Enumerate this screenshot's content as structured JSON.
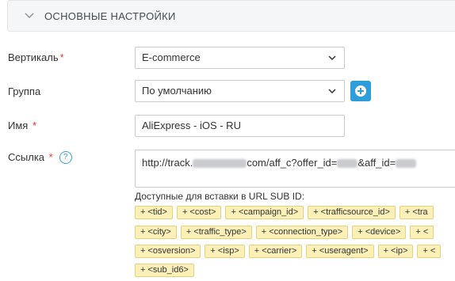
{
  "section": {
    "title": "ОСНОВНЫЕ НАСТРОЙКИ",
    "icon": "chevron-down-icon"
  },
  "form": {
    "vertical": {
      "label": "Вертикаль",
      "required_mark": "*",
      "value": "E-commerce"
    },
    "group": {
      "label": "Группа",
      "value": "По умолчанию",
      "add_icon": "plus-circle-icon"
    },
    "name": {
      "label": "Имя",
      "required_mark": "*",
      "value": "AliExpress - iOS - RU"
    },
    "link": {
      "label": "Ссылка",
      "required_mark": "*",
      "help": "?",
      "url_parts": [
        "http://track.",
        "com/aff_c?offer_id=",
        "&aff_id="
      ]
    }
  },
  "macros": {
    "title": "Доступные для вставки в URL SUB ID:",
    "rows": [
      [
        "+ <tid>",
        "+ <cost>",
        "+ <campaign_id>",
        "+ <trafficsource_id>",
        "+ <tra"
      ],
      [
        "+ <city>",
        "+ <traffic_type>",
        "+ <connection_type>",
        "+ <device>",
        "+ <"
      ],
      [
        "+ <osversion>",
        "+ <isp>",
        "+ <carrier>",
        "+ <useragent>",
        "+ <ip>",
        "+ <"
      ],
      [
        "+ <sub_id6>"
      ]
    ]
  },
  "colors": {
    "accent": "#2d9ddb",
    "required": "#e3342f",
    "tag_bg": "#fbf0b8"
  }
}
